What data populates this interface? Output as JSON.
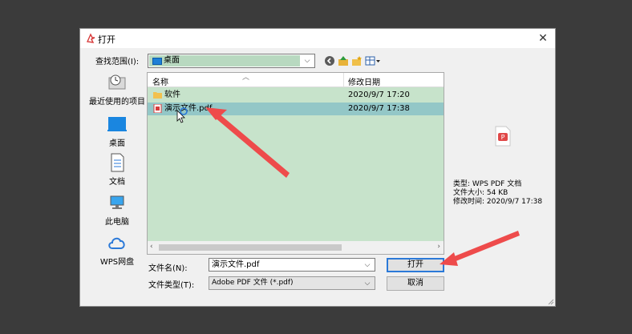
{
  "window": {
    "title": "打开",
    "close_glyph": "✕"
  },
  "look_in": {
    "label": "查找范围(I):",
    "value": "桌面"
  },
  "toolbar_icons": [
    "back-icon",
    "up-folder-icon",
    "new-folder-icon",
    "view-menu-icon"
  ],
  "places": [
    {
      "label": "最近使用的项目",
      "icon": "recent-items-icon"
    },
    {
      "label": "桌面",
      "icon": "desktop-icon"
    },
    {
      "label": "文档",
      "icon": "documents-icon"
    },
    {
      "label": "此电脑",
      "icon": "this-pc-icon"
    },
    {
      "label": "WPS网盘",
      "icon": "cloud-icon"
    }
  ],
  "file_list": {
    "columns": [
      "名称",
      "修改日期"
    ],
    "rows": [
      {
        "name": "软件",
        "date": "2020/9/7 17:20",
        "icon": "folder-icon",
        "selected": false
      },
      {
        "name": "演示文件.pdf",
        "date": "2020/9/7 17:38",
        "icon": "pdf-icon",
        "selected": true
      }
    ]
  },
  "preview": {
    "type_line": "类型: WPS PDF 文档",
    "size_line": "文件大小: 54 KB",
    "modified_line": "修改时间: 2020/9/7 17:38"
  },
  "file_name": {
    "label": "文件名(N):",
    "value": "演示文件.pdf"
  },
  "file_type": {
    "label": "文件类型(T):",
    "value": "Adobe PDF 文件 (*.pdf)"
  },
  "buttons": {
    "open": "打开",
    "cancel": "取消"
  },
  "colors": {
    "list_bg": "#c7e3cb",
    "selection": "#93c7c7",
    "annotation_arrow": "#ee4b4b",
    "accent": "#2b79d8"
  }
}
